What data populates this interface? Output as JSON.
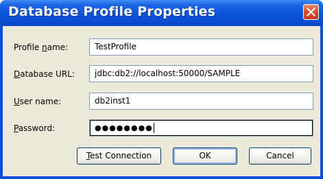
{
  "window": {
    "title": "Database Profile Properties"
  },
  "form": {
    "profile_name": {
      "label_mnemonic": "",
      "label_pre": "Profile ",
      "label_key": "n",
      "label_post": "ame:",
      "value": "TestProfile"
    },
    "database_url": {
      "label_key": "D",
      "label_post": "atabase URL:",
      "value": "jdbc:db2://localhost:50000/SAMPLE"
    },
    "user_name": {
      "label_key": "U",
      "label_post": "ser name:",
      "value": "db2inst1"
    },
    "password": {
      "label_key": "P",
      "label_post": "assword:",
      "masked_value": "●●●●●●●●"
    }
  },
  "buttons": {
    "test_connection": {
      "key": "T",
      "rest": "est Connection"
    },
    "ok": "OK",
    "cancel": "Cancel"
  },
  "icons": {
    "close": "close-icon"
  },
  "colors": {
    "titlebar": "#0a54db",
    "close_button": "#d9502c",
    "dialog_background": "#ece9d8",
    "field_border": "#7f9db9"
  }
}
